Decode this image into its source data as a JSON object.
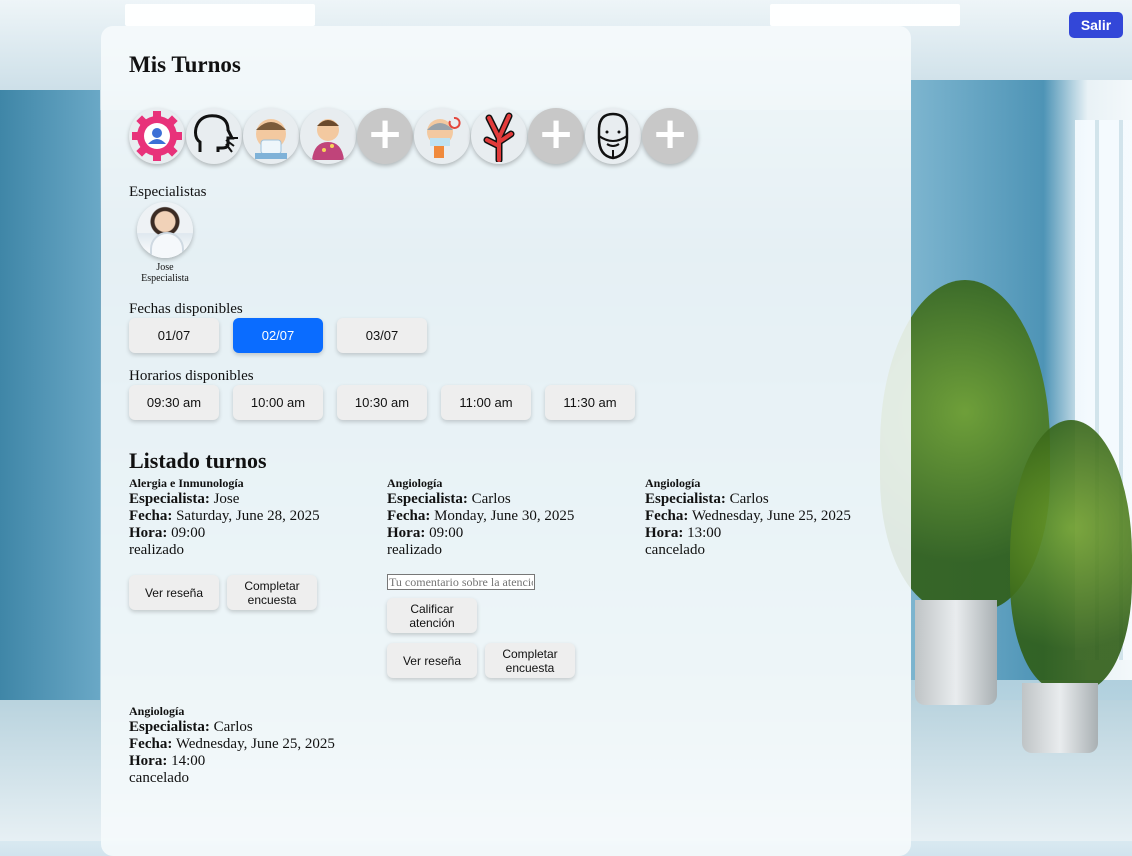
{
  "header": {
    "title": "Mis Turnos",
    "logout_label": "Salir"
  },
  "specialties": [
    {
      "icon": "gear-person-icon",
      "kind": "image"
    },
    {
      "icon": "cough-icon",
      "kind": "image"
    },
    {
      "icon": "sneeze-icon",
      "kind": "image"
    },
    {
      "icon": "dermatology-icon",
      "kind": "image"
    },
    {
      "icon": "plus-icon",
      "kind": "plus",
      "glyph": "+"
    },
    {
      "icon": "nebulizer-icon",
      "kind": "image"
    },
    {
      "icon": "blood-vessel-icon",
      "kind": "image"
    },
    {
      "icon": "plus-icon",
      "kind": "plus",
      "glyph": "+"
    },
    {
      "icon": "bearded-face-icon",
      "kind": "image"
    },
    {
      "icon": "plus-icon",
      "kind": "plus",
      "glyph": "+"
    }
  ],
  "especialistas": {
    "label": "Especialistas",
    "items": [
      {
        "name": "Jose",
        "role": "Especialista"
      }
    ]
  },
  "fechas": {
    "label": "Fechas disponibles",
    "items": [
      "01/07",
      "02/07",
      "03/07"
    ],
    "selected": "02/07"
  },
  "horarios": {
    "label": "Horarios disponibles",
    "items": [
      "09:30 am",
      "10:00 am",
      "10:30 am",
      "11:00 am",
      "11:30 am"
    ]
  },
  "listado": {
    "title": "Listado turnos",
    "labels": {
      "especialista": "Especialista:",
      "fecha": "Fecha:",
      "hora": "Hora:"
    },
    "buttons": {
      "ver_resena": "Ver reseña",
      "completar_encuesta": "Completar encuesta",
      "calificar": "Calificar atención",
      "comment_placeholder": "Tu comentario sobre la atención"
    },
    "turnos": [
      {
        "especialidad": "Alergia e Inmunología",
        "especialista": "Jose",
        "fecha": "Saturday, June 28, 2025",
        "hora": "09:00",
        "estado": "realizado"
      },
      {
        "especialidad": "Angiología",
        "especialista": "Carlos",
        "fecha": "Monday, June 30, 2025",
        "hora": "09:00",
        "estado": "realizado"
      },
      {
        "especialidad": "Angiología",
        "especialista": "Carlos",
        "fecha": "Wednesday, June 25, 2025",
        "hora": "13:00",
        "estado": "cancelado"
      },
      {
        "especialidad": "Angiología",
        "especialista": "Carlos",
        "fecha": "Wednesday, June 25, 2025",
        "hora": "14:00",
        "estado": "cancelado"
      }
    ]
  },
  "colors": {
    "primary": "#0a6cff",
    "logout": "#3347d8",
    "chip": "#eeeeee",
    "plus": "#c8c8c8"
  }
}
